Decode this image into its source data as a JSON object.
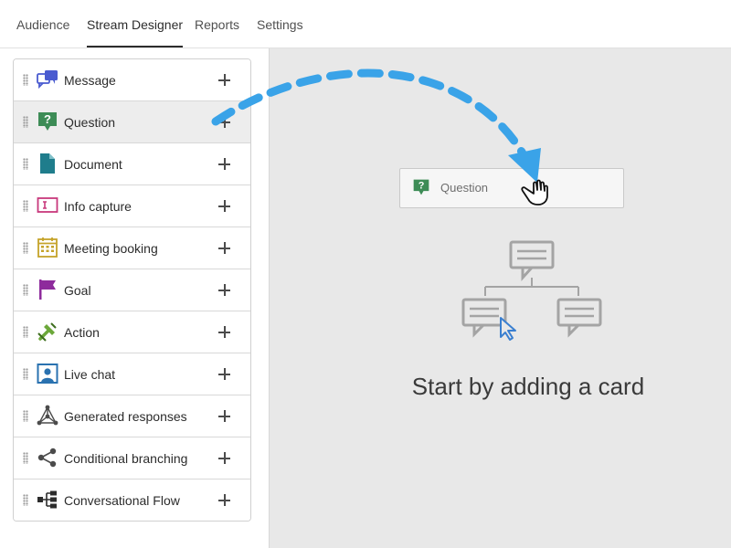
{
  "nav": {
    "tabs": [
      {
        "label": "Audience"
      },
      {
        "label": "Stream Designer"
      },
      {
        "label": "Reports"
      },
      {
        "label": "Settings"
      }
    ],
    "active_tab": "Stream Designer"
  },
  "sidebar": {
    "items": [
      {
        "label": "Message",
        "icon": "message-icon"
      },
      {
        "label": "Question",
        "icon": "question-icon"
      },
      {
        "label": "Document",
        "icon": "document-icon"
      },
      {
        "label": "Info capture",
        "icon": "info-capture-icon"
      },
      {
        "label": "Meeting booking",
        "icon": "calendar-icon"
      },
      {
        "label": "Goal",
        "icon": "flag-icon"
      },
      {
        "label": "Action",
        "icon": "action-icon"
      },
      {
        "label": "Live chat",
        "icon": "live-chat-icon"
      },
      {
        "label": "Generated responses",
        "icon": "generated-responses-icon"
      },
      {
        "label": "Conditional branching",
        "icon": "branching-icon"
      },
      {
        "label": "Conversational Flow",
        "icon": "conversational-flow-icon"
      }
    ]
  },
  "canvas": {
    "dragged_card": {
      "label": "Question",
      "icon": "question-icon"
    },
    "empty_state_title": "Start by adding a card",
    "illustration": "branching-chat-bubbles-icon",
    "cursor": "grab-hand-icon"
  },
  "colors": {
    "arrow": "#3aa3e8",
    "question_green": "#3d8c56",
    "message_blue": "#4a5bd0",
    "document_teal": "#1f7d8c",
    "info_capture_pink": "#c8387c",
    "calendar_gold": "#c5a32a",
    "goal_purple": "#8e2b9c",
    "action_green": "#6ca83a",
    "live_chat_blue": "#2a72b0",
    "canvas_bg": "#e8e8e8"
  }
}
